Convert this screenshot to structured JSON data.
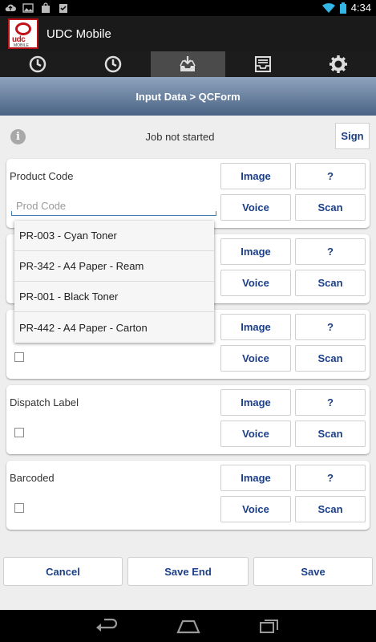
{
  "status_bar": {
    "time": "4:34"
  },
  "app": {
    "title": "UDC Mobile",
    "logo_text": "udc",
    "logo_sub": "MOBILE"
  },
  "tabs": [
    {
      "icon": "clock-icon"
    },
    {
      "icon": "clock-icon"
    },
    {
      "icon": "inbox-download-icon",
      "active": true
    },
    {
      "icon": "tray-icon"
    },
    {
      "icon": "gear-icon"
    }
  ],
  "header": {
    "breadcrumb": "Input Data > QCForm"
  },
  "job": {
    "status": "Job not started",
    "sign_label": "Sign"
  },
  "buttons": {
    "image": "Image",
    "help": "?",
    "voice": "Voice",
    "scan": "Scan"
  },
  "fields": [
    {
      "label": "Product Code",
      "placeholder": "Prod Code"
    },
    {
      "label": ""
    },
    {
      "label": ""
    },
    {
      "label": "Dispatch Label"
    },
    {
      "label": "Barcoded"
    }
  ],
  "dropdown": {
    "options": [
      "PR-003 - Cyan Toner",
      "PR-342 - A4 Paper - Ream",
      "PR-001 - Black Toner",
      "PR-442 - A4 Paper - Carton"
    ]
  },
  "actions": {
    "cancel": "Cancel",
    "save_end": "Save End",
    "save": "Save"
  },
  "colors": {
    "accent": "#1c3f8a",
    "header_top": "#8ea3bd",
    "header_bottom": "#4b6485",
    "brand": "#c1121b"
  }
}
